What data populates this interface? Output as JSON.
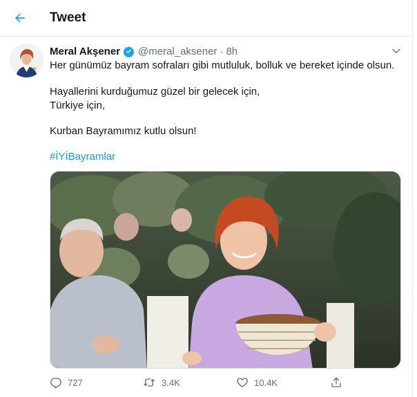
{
  "header": {
    "title": "Tweet",
    "back_icon": "arrow-left-icon"
  },
  "tweet": {
    "author": {
      "name": "Meral Akşener",
      "handle": "@meral_aksener",
      "verified": true
    },
    "separator": "·",
    "time": "8h",
    "lines": [
      "Her günümüz bayram sofraları gibi mutluluk, bolluk ve bereket içinde olsun.",
      "Hayallerini kurduğumuz güzel bir gelecek için,",
      "Türkiye için,",
      "Kurban Bayramımız kutlu olsun!"
    ],
    "hashtag": "#İYİBayramlar",
    "media": {
      "kind": "video-still"
    },
    "stats": {
      "replies": "727",
      "retweets": "3.4K",
      "likes": "10.4K"
    }
  },
  "colors": {
    "accent": "#1da1f2",
    "link": "#1b95e0",
    "muted": "#5b7083",
    "border": "#e6ecf0"
  }
}
